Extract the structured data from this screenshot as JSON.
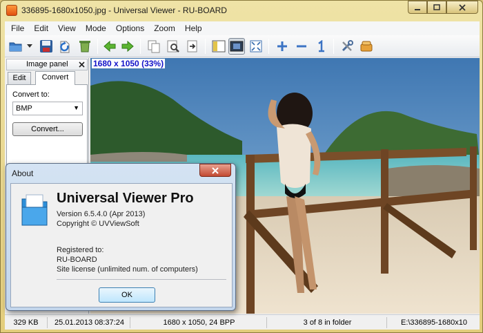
{
  "window": {
    "title": "336895-1680x1050.jpg - Universal Viewer - RU-BOARD",
    "minimize_label": "🗕",
    "maximize_label": "🗖",
    "close_label": "✕"
  },
  "menu": [
    "File",
    "Edit",
    "View",
    "Mode",
    "Options",
    "Zoom",
    "Help"
  ],
  "toolbar": {
    "icons": [
      "open-folder-icon",
      "dropdown-arrow-icon",
      "save-icon",
      "refresh-icon",
      "delete-icon",
      "arrow-left-icon",
      "arrow-right-icon",
      "copy-icon",
      "find-icon",
      "export-icon",
      "panel-icon",
      "fit-window-icon",
      "fullscreen-icon",
      "zoom-in-icon",
      "zoom-out-icon",
      "zoom-original-icon",
      "settings-icon",
      "plugins-icon"
    ]
  },
  "panel": {
    "title": "Image panel",
    "close_label": "✕",
    "tabs": [
      "Edit",
      "Convert"
    ],
    "active_tab": "Convert",
    "convert_to_label": "Convert to:",
    "format_value": "BMP",
    "convert_button": "Convert..."
  },
  "image": {
    "zoom_label": "1680 x 1050 (33%)"
  },
  "status": {
    "size": "329 KB",
    "date": "25.01.2013 08:37:24",
    "dimensions": "1680 x 1050, 24 BPP",
    "position": "3 of 8 in folder",
    "path": "E:\\336895-1680x10"
  },
  "about": {
    "title": "About",
    "close_label": "✕",
    "app_name": "Universal Viewer Pro",
    "version": "Version 6.5.4.0 (Apr 2013)",
    "copyright": "Copyright © UVViewSoft",
    "registered_to_label": "Registered to:",
    "registered_name": "RU-BOARD",
    "license": "Site license (unlimited num. of computers)",
    "ok_button": "OK"
  },
  "colors": {
    "window_frame": "#e3cd7c",
    "zoom_text": "#1010c8",
    "dialog_frame": "#c3d6ec"
  }
}
